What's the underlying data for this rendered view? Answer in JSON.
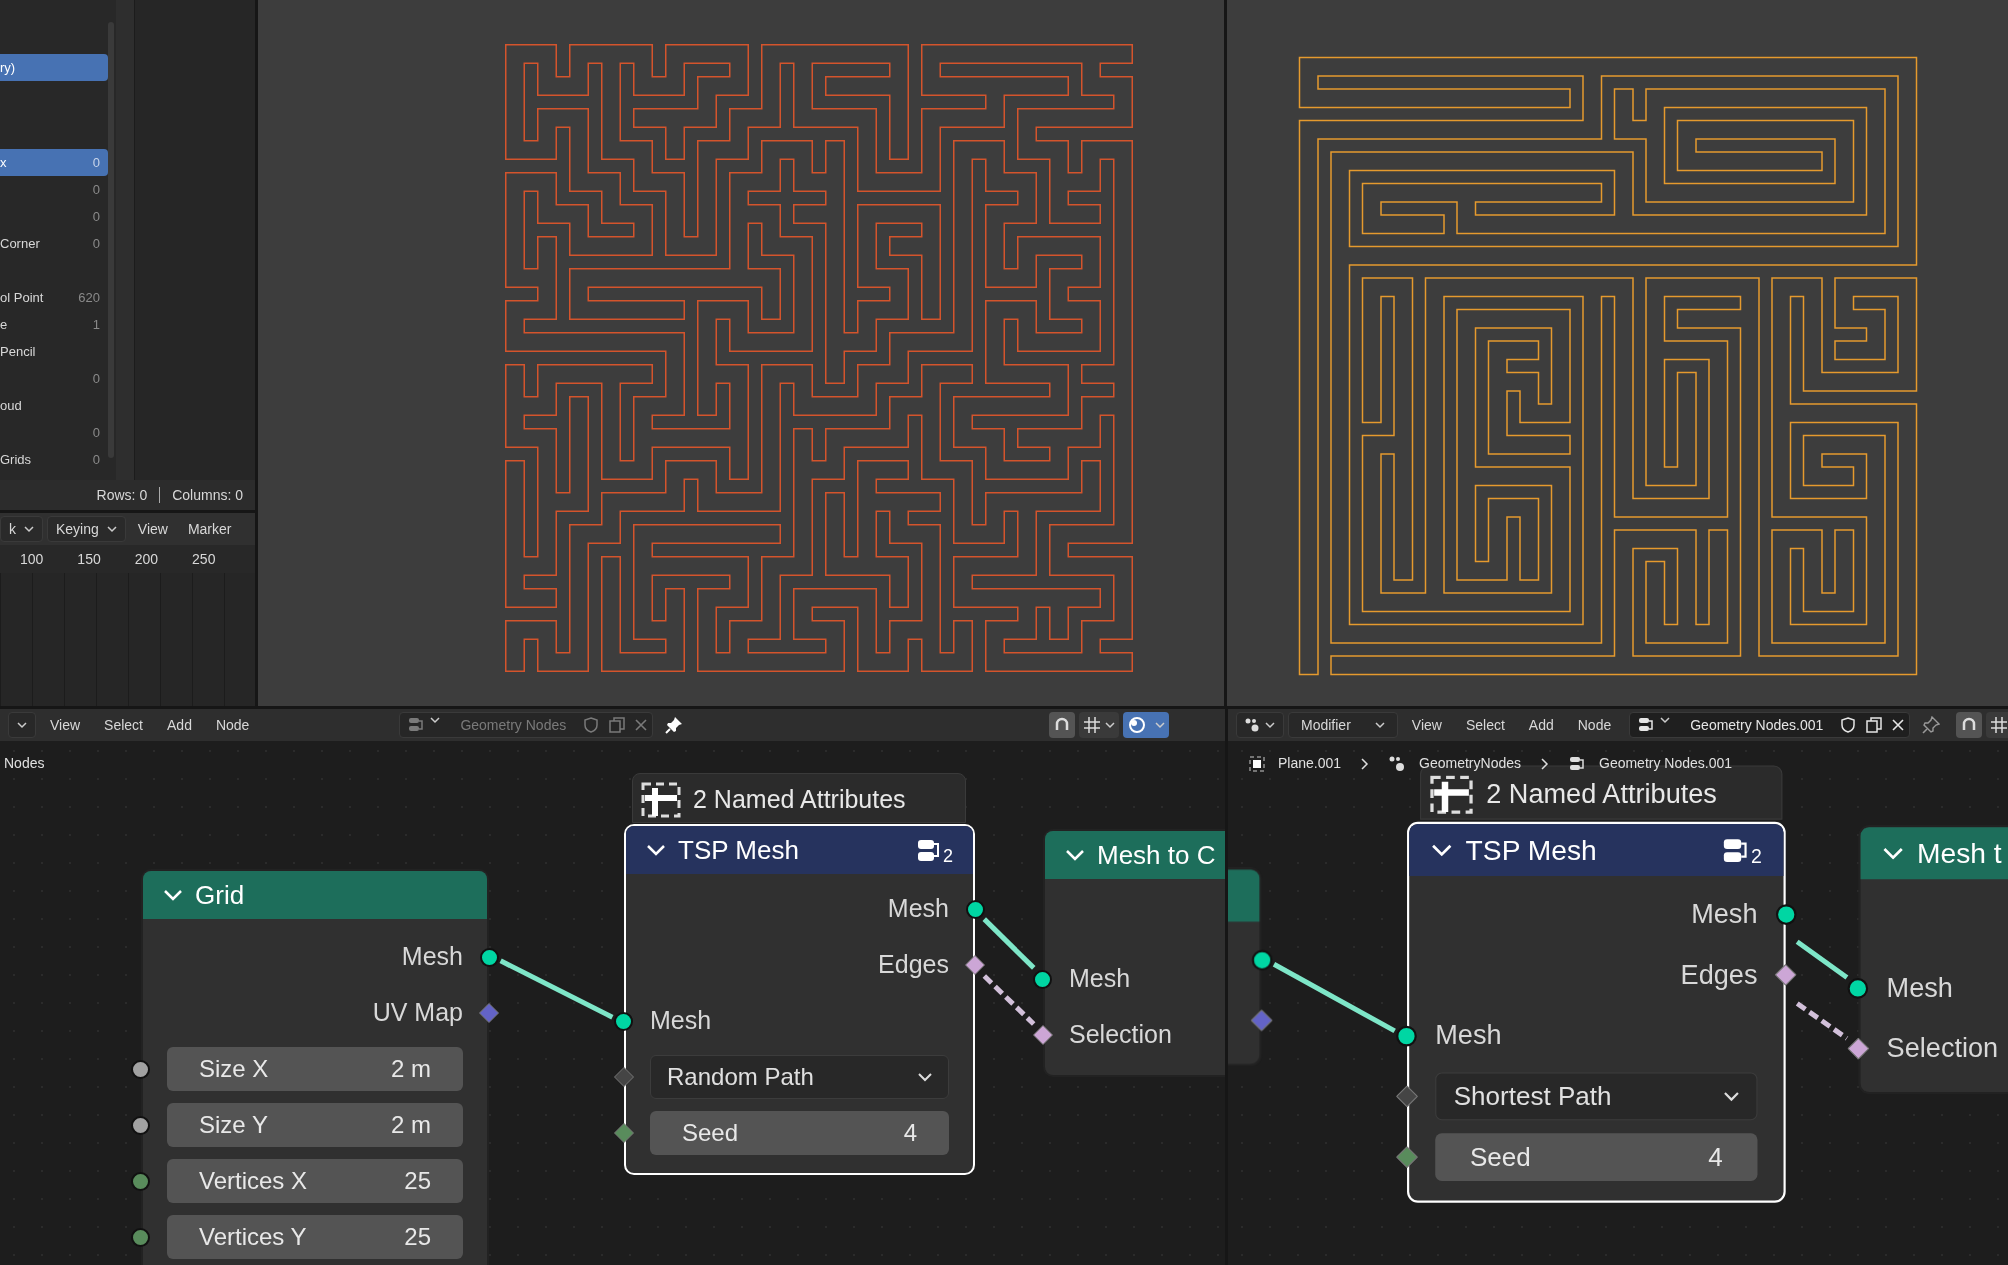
{
  "spreadsheet": {
    "rows": [
      {
        "label": "ry)",
        "selected": true
      },
      {
        "label": "x",
        "value": "0",
        "selected": true
      },
      {
        "value": "0",
        "selected": false
      },
      {
        "value": "0",
        "selected": false
      },
      {
        "label": "Corner",
        "value": "0",
        "selected": false
      },
      {
        "label": "ol Point",
        "value": "620",
        "selected": false
      },
      {
        "label": "e",
        "value": "1",
        "selected": false
      },
      {
        "label": "Pencil",
        "selected": false
      },
      {
        "value": "0",
        "selected": false
      },
      {
        "label": "oud",
        "selected": false
      },
      {
        "value": "0",
        "selected": false
      },
      {
        "label": "Grids",
        "value": "0",
        "selected": false
      }
    ],
    "footer": {
      "rows": "Rows: 0",
      "columns": "Columns: 0"
    }
  },
  "timeline": {
    "menu": [
      {
        "label": "k",
        "kind": "dropdown"
      },
      {
        "label": "Keying",
        "kind": "dropdown"
      },
      {
        "label": "View",
        "kind": "menu"
      },
      {
        "label": "Marker",
        "kind": "menu"
      }
    ],
    "ruler": [
      "100",
      "150",
      "200",
      "250"
    ]
  },
  "node_editors": [
    {
      "header": {
        "menus": [
          "View",
          "Select",
          "Add",
          "Node"
        ],
        "tree": "Geometry Nodes",
        "tree_active": false,
        "pinned": true
      },
      "breadcrumb": [
        "Nodes"
      ],
      "frame": "2 Named Attributes",
      "nodes": [
        {
          "title": "Grid",
          "kind": "geometry",
          "selected": false,
          "rows": [
            {
              "kind": "output",
              "label": "Mesh",
              "socket": {
                "kind": "circle",
                "color": "#00d6a3"
              }
            },
            {
              "kind": "output",
              "label": "UV Map",
              "socket": {
                "kind": "diamond",
                "color": "#6363c7"
              }
            },
            {
              "kind": "field",
              "label": "Size X",
              "value": "2 m",
              "socket": {
                "kind": "circle",
                "color": "#a1a1a1"
              }
            },
            {
              "kind": "field",
              "label": "Size Y",
              "value": "2 m",
              "socket": {
                "kind": "circle",
                "color": "#a1a1a1"
              }
            },
            {
              "kind": "field",
              "label": "Vertices X",
              "value": "25",
              "socket": {
                "kind": "circle",
                "color": "#598c5c"
              }
            },
            {
              "kind": "field",
              "label": "Vertices Y",
              "value": "25",
              "socket": {
                "kind": "circle",
                "color": "#598c5c"
              }
            }
          ]
        },
        {
          "title": "TSP Mesh",
          "kind": "group",
          "selected": true,
          "badge": "2",
          "rows": [
            {
              "kind": "output",
              "label": "Mesh",
              "socket": {
                "kind": "circle",
                "color": "#00d6a3"
              }
            },
            {
              "kind": "output",
              "label": "Edges",
              "socket": {
                "kind": "diamond",
                "color": "#cca6d6"
              }
            },
            {
              "kind": "input",
              "label": "Mesh",
              "socket": {
                "kind": "circle",
                "color": "#00d6a3"
              }
            },
            {
              "kind": "dropdown",
              "label": "Random Path",
              "socket": {
                "kind": "diamond",
                "color": "#454545"
              }
            },
            {
              "kind": "field",
              "label": "Seed",
              "value": "4",
              "socket": {
                "kind": "diamond",
                "color": "#598c5c"
              }
            }
          ]
        },
        {
          "title": "Mesh to C",
          "kind": "geometry",
          "selected": false,
          "rows": [
            {
              "kind": "input",
              "label": "Mesh",
              "socket": {
                "kind": "circle",
                "color": "#00d6a3"
              }
            },
            {
              "kind": "input",
              "label": "Selection",
              "socket": {
                "kind": "diamond",
                "color": "#cca6d6"
              }
            }
          ]
        }
      ]
    },
    {
      "header": {
        "mode": "Modifier",
        "menus": [
          "View",
          "Select",
          "Add",
          "Node"
        ],
        "tree": "Geometry Nodes.001",
        "tree_active": true,
        "pinned": false
      },
      "breadcrumb": [
        "Plane.001",
        "GeometryNodes",
        "Geometry Nodes.001"
      ],
      "frame": "2 Named Attributes",
      "nodes": [
        {
          "kind": "geometry",
          "selected": false,
          "rows": [
            {
              "kind": "output",
              "socket": {
                "kind": "circle",
                "color": "#00d6a3"
              }
            },
            {
              "kind": "output",
              "socket": {
                "kind": "diamond",
                "color": "#6363c7"
              }
            }
          ]
        },
        {
          "title": "TSP Mesh",
          "kind": "group",
          "selected": true,
          "badge": "2",
          "rows": [
            {
              "kind": "output",
              "label": "Mesh",
              "socket": {
                "kind": "circle",
                "color": "#00d6a3"
              }
            },
            {
              "kind": "output",
              "label": "Edges",
              "socket": {
                "kind": "diamond",
                "color": "#cca6d6"
              }
            },
            {
              "kind": "input",
              "label": "Mesh",
              "socket": {
                "kind": "circle",
                "color": "#00d6a3"
              }
            },
            {
              "kind": "dropdown",
              "label": "Shortest Path",
              "socket": {
                "kind": "diamond",
                "color": "#454545"
              }
            },
            {
              "kind": "field",
              "label": "Seed",
              "value": "4",
              "socket": {
                "kind": "diamond",
                "color": "#598c5c"
              }
            }
          ]
        },
        {
          "title": "Mesh t",
          "kind": "geometry",
          "selected": false,
          "rows": [
            {
              "kind": "input",
              "label": "Mesh",
              "socket": {
                "kind": "circle",
                "color": "#00d6a3"
              }
            },
            {
              "kind": "input",
              "label": "Selection",
              "socket": {
                "kind": "diamond",
                "color": "#cca6d6"
              }
            }
          ]
        }
      ]
    }
  ]
}
